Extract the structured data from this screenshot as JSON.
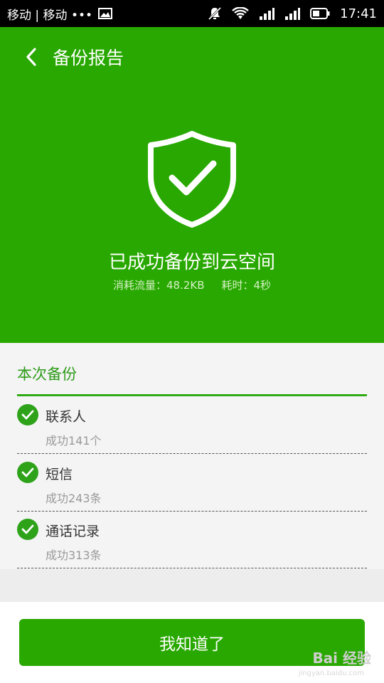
{
  "status_bar": {
    "carrier": "移动 | 移动 •••",
    "time": "17:41"
  },
  "header": {
    "title": "备份报告"
  },
  "result": {
    "message": "已成功备份到云空间",
    "traffic": "消耗流量：48.2KB",
    "duration": "耗时：4秒"
  },
  "section": {
    "title": "本次备份",
    "items": [
      {
        "name": "联系人",
        "detail": "成功141个"
      },
      {
        "name": "短信",
        "detail": "成功243条"
      },
      {
        "name": "通话记录",
        "detail": "成功313条"
      }
    ]
  },
  "footer": {
    "button_label": "我知道了"
  },
  "watermark": {
    "text": "Bai 经验",
    "url": "jingyan.baidu.com"
  },
  "colors": {
    "primary_green": "#28a800",
    "section_title": "#2e9b1a"
  }
}
